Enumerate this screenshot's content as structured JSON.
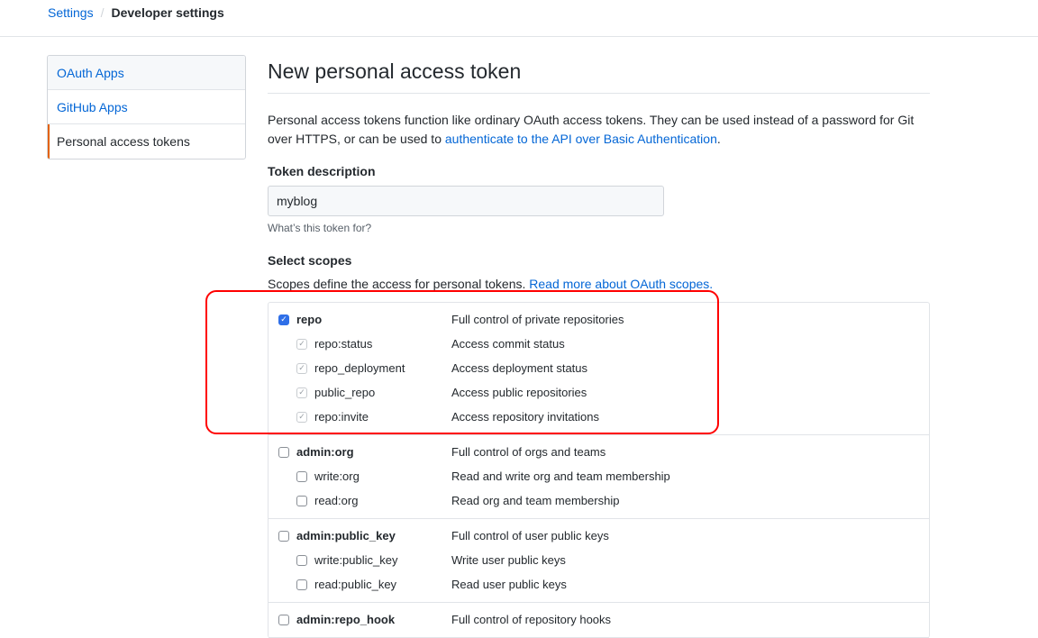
{
  "breadcrumb": {
    "parent": "Settings",
    "separator": "/",
    "current": "Developer settings"
  },
  "sidebar": {
    "items": [
      {
        "label": "OAuth Apps",
        "state": "hover"
      },
      {
        "label": "GitHub Apps",
        "state": "normal"
      },
      {
        "label": "Personal access tokens",
        "state": "selected"
      }
    ]
  },
  "main": {
    "title": "New personal access token",
    "intro_text": "Personal access tokens function like ordinary OAuth access tokens. They can be used instead of a password for Git over HTTPS, or can be used to ",
    "intro_link": "authenticate to the API over Basic Authentication",
    "intro_end": ".",
    "token_description": {
      "label": "Token description",
      "value": "myblog",
      "note": "What’s this token for?"
    },
    "scopes": {
      "label": "Select scopes",
      "help_text": "Scopes define the access for personal tokens. ",
      "help_link": "Read more about OAuth scopes.",
      "groups": [
        {
          "name": "repo",
          "description": "Full control of private repositories",
          "checked": true,
          "children": [
            {
              "name": "repo:status",
              "description": "Access commit status",
              "checked": true
            },
            {
              "name": "repo_deployment",
              "description": "Access deployment status",
              "checked": true
            },
            {
              "name": "public_repo",
              "description": "Access public repositories",
              "checked": true
            },
            {
              "name": "repo:invite",
              "description": "Access repository invitations",
              "checked": true
            }
          ]
        },
        {
          "name": "admin:org",
          "description": "Full control of orgs and teams",
          "checked": false,
          "children": [
            {
              "name": "write:org",
              "description": "Read and write org and team membership",
              "checked": false
            },
            {
              "name": "read:org",
              "description": "Read org and team membership",
              "checked": false
            }
          ]
        },
        {
          "name": "admin:public_key",
          "description": "Full control of user public keys",
          "checked": false,
          "children": [
            {
              "name": "write:public_key",
              "description": "Write user public keys",
              "checked": false
            },
            {
              "name": "read:public_key",
              "description": "Read user public keys",
              "checked": false
            }
          ]
        },
        {
          "name": "admin:repo_hook",
          "description": "Full control of repository hooks",
          "checked": false,
          "children": []
        }
      ]
    }
  },
  "colors": {
    "link": "#0366d6",
    "selected_accent": "#e36209",
    "checkbox_checked": "#2f6fe8",
    "annotation": "#ff0000"
  }
}
